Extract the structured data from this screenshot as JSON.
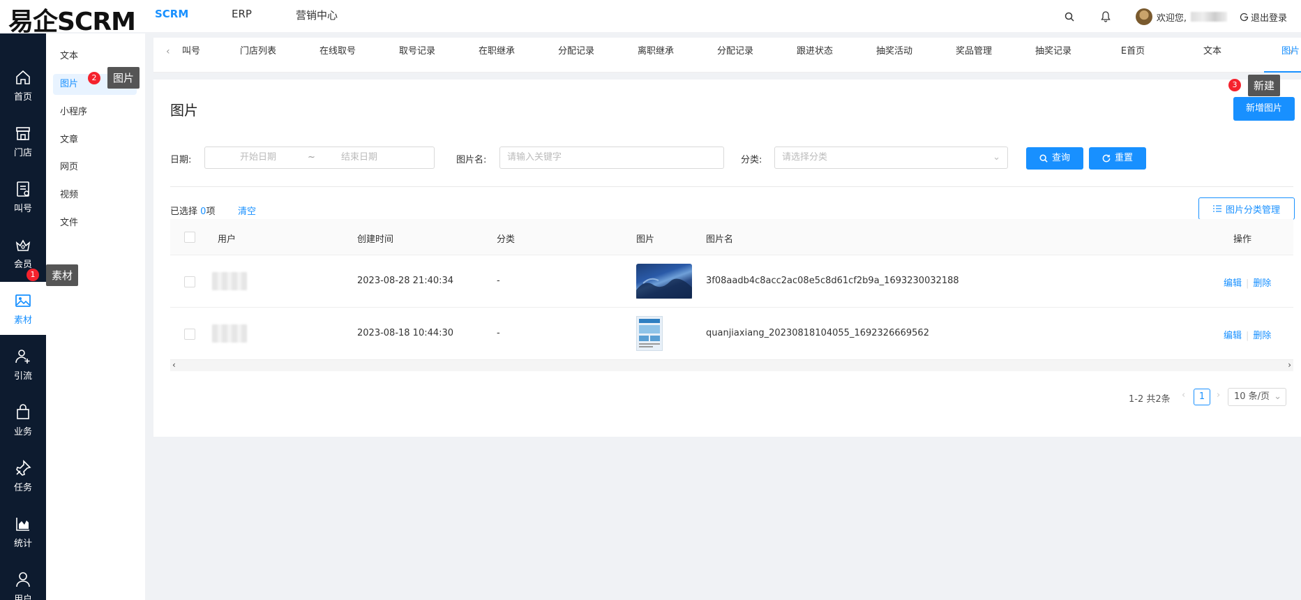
{
  "app": {
    "logo": "易企SCRM"
  },
  "topnav": [
    {
      "label": "SCRM",
      "active": true
    },
    {
      "label": "ERP",
      "active": false
    },
    {
      "label": "营销中心",
      "active": false
    }
  ],
  "header": {
    "welcome": "欢迎您,",
    "logout": "退出登录"
  },
  "sidebar": [
    {
      "label": "首页",
      "icon": "home-icon"
    },
    {
      "label": "门店",
      "icon": "store-icon"
    },
    {
      "label": "叫号",
      "icon": "queue-icon"
    },
    {
      "label": "会员",
      "icon": "member-icon"
    },
    {
      "label": "素材",
      "icon": "image-icon",
      "active": true
    },
    {
      "label": "引流",
      "icon": "user-plus-icon"
    },
    {
      "label": "业务",
      "icon": "bag-icon"
    },
    {
      "label": "任务",
      "icon": "pin-icon"
    },
    {
      "label": "统计",
      "icon": "chart-icon"
    },
    {
      "label": "用户",
      "icon": "user-icon"
    }
  ],
  "subsidebar": [
    {
      "label": "文本"
    },
    {
      "label": "图片",
      "active": true
    },
    {
      "label": "小程序"
    },
    {
      "label": "文章"
    },
    {
      "label": "网页"
    },
    {
      "label": "视频"
    },
    {
      "label": "文件"
    }
  ],
  "tabs": [
    {
      "label": "叫号"
    },
    {
      "label": "门店列表"
    },
    {
      "label": "在线取号"
    },
    {
      "label": "取号记录"
    },
    {
      "label": "在职继承"
    },
    {
      "label": "分配记录"
    },
    {
      "label": "离职继承"
    },
    {
      "label": "分配记录"
    },
    {
      "label": "跟进状态"
    },
    {
      "label": "抽奖活动"
    },
    {
      "label": "奖品管理"
    },
    {
      "label": "抽奖记录"
    },
    {
      "label": "E首页"
    },
    {
      "label": "文本"
    },
    {
      "label": "图片",
      "active": true
    }
  ],
  "page": {
    "title": "图片",
    "new_button": "新增图片",
    "filters": {
      "date_label": "日期:",
      "start_placeholder": "开始日期",
      "range_sep": "~",
      "end_placeholder": "结束日期",
      "name_label": "图片名:",
      "name_placeholder": "请输入关键字",
      "category_label": "分类:",
      "category_placeholder": "请选择分类",
      "query_button": "查询",
      "reset_button": "重置"
    },
    "selection": {
      "prefix": "已选择",
      "count": "0",
      "suffix": "项",
      "clear": "清空"
    },
    "category_manage_button": "图片分类管理",
    "table": {
      "columns": [
        "用户",
        "创建时间",
        "分类",
        "图片",
        "图片名",
        "操作"
      ],
      "rows": [
        {
          "created": "2023-08-28 21:40:34",
          "category": "-",
          "name": "3f08aadb4c8acc2ac08e5c8d61cf2b9a_1693230032188",
          "edit": "编辑",
          "delete": "删除"
        },
        {
          "created": "2023-08-18 10:44:30",
          "category": "-",
          "name": "quanjiaxiang_20230818104055_1692326669562",
          "edit": "编辑",
          "delete": "删除"
        }
      ]
    },
    "pagination": {
      "summary": "1-2 共2条",
      "current": "1",
      "page_size": "10 条/页"
    }
  },
  "annotations": [
    {
      "num": "1",
      "text": "素材"
    },
    {
      "num": "2",
      "text": "图片"
    },
    {
      "num": "3",
      "text": "新建"
    }
  ],
  "colors": {
    "primary": "#1890ff",
    "sidebar_bg": "#0d1b2f",
    "badge": "#f5222d"
  }
}
